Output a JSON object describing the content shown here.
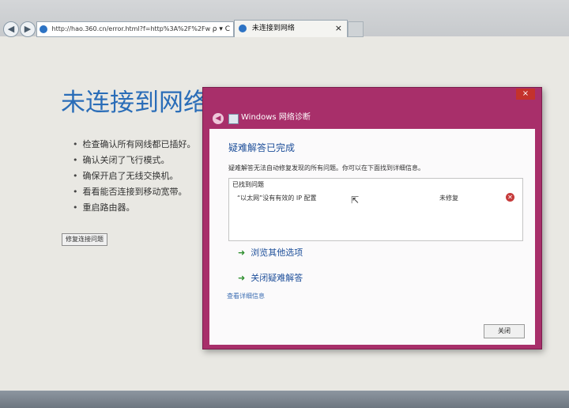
{
  "browser": {
    "address": "http://hao.360.cn/error.html?f=http%3A%2F%2Fw",
    "address_tools": "ρ ▾ C",
    "tab_title": "未连接到网络",
    "tab_close": "×"
  },
  "error_page": {
    "title": "未连接到网络",
    "tips": [
      "检查确认所有网线都已插好。",
      "确认关闭了飞行模式。",
      "确保开启了无线交换机。",
      "看看能否连接到移动宽带。",
      "重启路由器。"
    ],
    "repair_button": "修复连接问题"
  },
  "dialog": {
    "title": "Windows 网络诊断",
    "close_glyph": "×",
    "heading": "疑难解答已完成",
    "description": "疑难解答无法自动修复发现的所有问题。你可以在下面找到详细信息。",
    "issues_header": "已找到问题",
    "issues": [
      {
        "text": "“以太网”没有有效的 IP 配置",
        "status": "未修复"
      }
    ],
    "options": [
      "浏览其他选项",
      "关闭疑难解答"
    ],
    "details_link": "查看详细信息",
    "close_button": "关闭"
  },
  "colors": {
    "dialog_border": "#a82f6a",
    "heading_blue": "#1e4f9a",
    "error_title_blue": "#2a6db8"
  }
}
